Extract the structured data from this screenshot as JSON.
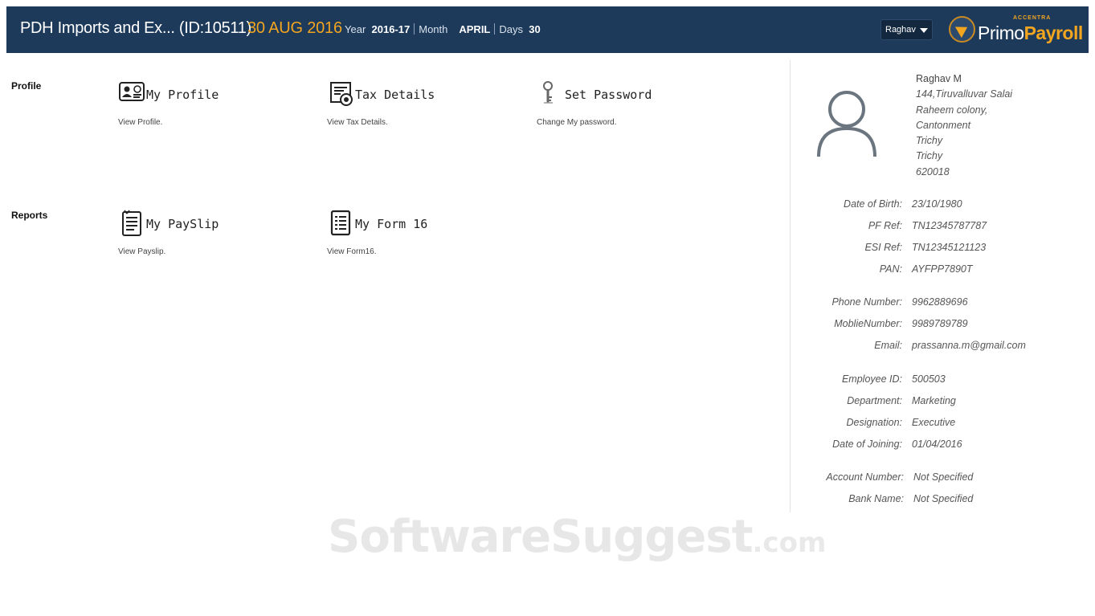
{
  "header": {
    "company": "PDH Imports and Ex... (ID:10511)",
    "date": "30 AUG 2016",
    "year_label": "Year",
    "year_value": "2016-17",
    "month_label": "Month",
    "month_value": "APRIL",
    "days_label": "Days",
    "days_value": "30",
    "user": "Raghav",
    "brand_small": "ACCENTRA",
    "brand_primo": "Primo",
    "brand_payroll": "Payroll",
    "bg_color": "#1d3a5b",
    "accent_color": "#f2a51f"
  },
  "sections": {
    "profile": "Profile",
    "reports": "Reports"
  },
  "tiles": {
    "my_profile": {
      "title": "My Profile",
      "desc": "View Profile.",
      "icon": "id-card-icon"
    },
    "tax_details": {
      "title": "Tax Details",
      "desc": "View Tax Details.",
      "icon": "tax-document-icon"
    },
    "set_password": {
      "title": "Set Password",
      "desc": "Change My password.",
      "icon": "key-icon"
    },
    "my_payslip": {
      "title": "My PaySlip",
      "desc": "View Payslip.",
      "icon": "payslip-icon"
    },
    "my_form16": {
      "title": "My Form 16",
      "desc": "View Form16.",
      "icon": "form-icon"
    }
  },
  "employee": {
    "name": "Raghav M",
    "address": [
      "144,Tiruvalluvar Salai",
      "Raheem colony,",
      "Cantonment",
      "Trichy",
      "Trichy",
      "620018"
    ],
    "details": [
      {
        "label": "Date of Birth:",
        "value": "23/10/1980"
      },
      {
        "label": "PF Ref:",
        "value": "TN12345787787"
      },
      {
        "label": "ESI Ref:",
        "value": "TN12345121123"
      },
      {
        "label": "PAN:",
        "value": "AYFPP7890T"
      },
      {
        "label": "Phone Number:",
        "value": "9962889696"
      },
      {
        "label": "MoblieNumber:",
        "value": "9989789789"
      },
      {
        "label": "Email:",
        "value": "prassanna.m@gmail.com"
      },
      {
        "label": "Employee ID:",
        "value": "500503"
      },
      {
        "label": "Department:",
        "value": "Marketing"
      },
      {
        "label": "Designation:",
        "value": "Executive"
      },
      {
        "label": "Date of Joining:",
        "value": "01/04/2016"
      },
      {
        "label": "Account Number:",
        "value": "Not Specified"
      },
      {
        "label": "Bank Name:",
        "value": "Not Specified"
      }
    ]
  },
  "watermark": {
    "main": "SoftwareSuggest",
    "suffix": ".com"
  }
}
